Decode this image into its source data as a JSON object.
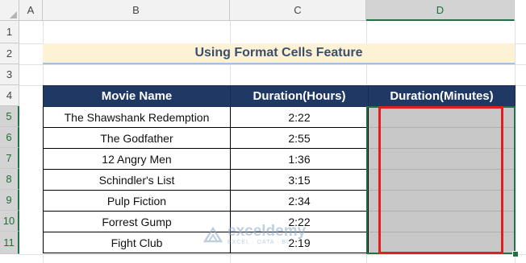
{
  "columns": [
    "A",
    "B",
    "C",
    "D"
  ],
  "rows": [
    "1",
    "2",
    "3",
    "4",
    "5",
    "6",
    "7",
    "8",
    "9",
    "10",
    "11"
  ],
  "title": "Using Format Cells Feature",
  "table": {
    "headers": [
      "Movie Name",
      "Duration(Hours)",
      "Duration(Minutes)"
    ],
    "rows": [
      {
        "movie": "The Shawshank Redemption",
        "hours": "2:22",
        "minutes": ""
      },
      {
        "movie": "The Godfather",
        "hours": "2:55",
        "minutes": ""
      },
      {
        "movie": "12 Angry Men",
        "hours": "1:36",
        "minutes": ""
      },
      {
        "movie": "Schindler's List",
        "hours": "3:15",
        "minutes": ""
      },
      {
        "movie": "Pulp Fiction",
        "hours": "2:34",
        "minutes": ""
      },
      {
        "movie": "Forrest Gump",
        "hours": "2:22",
        "minutes": ""
      },
      {
        "movie": "Fight Club",
        "hours": "2:19",
        "minutes": ""
      }
    ]
  },
  "watermark": {
    "name": "exceldemy",
    "tagline": "EXCEL · DATA · BI"
  },
  "colors": {
    "header_bg": "#203864",
    "title_bg": "#fdf2d6",
    "selection": "#217346",
    "highlight": "#e02020",
    "selected_fill": "#c8c8c8"
  }
}
